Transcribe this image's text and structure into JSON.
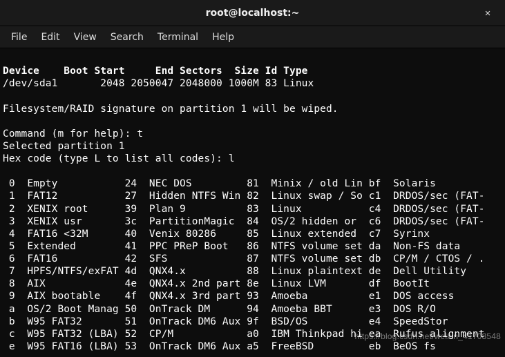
{
  "window": {
    "title": "root@localhost:~",
    "close_glyph": "×"
  },
  "menu": {
    "file": "File",
    "edit": "Edit",
    "view": "View",
    "search": "Search",
    "terminal": "Terminal",
    "help": "Help"
  },
  "header": {
    "cols": "Device    Boot Start     End Sectors  Size Id Type",
    "row1": "/dev/sda1       2048 2050047 2048000 1000M 83 Linux"
  },
  "msg": {
    "wipe": "Filesystem/RAID signature on partition 1 will be wiped.",
    "cmd_prompt": "Command (m for help): t",
    "selected": "Selected partition 1",
    "hex_prompt": "Hex code (type L to list all codes): l"
  },
  "codes": {
    "r00": " 0  Empty           24  NEC DOS         81  Minix / old Lin bf  Solaris",
    "r01": " 1  FAT12           27  Hidden NTFS Win 82  Linux swap / So c1  DRDOS/sec (FAT-",
    "r02": " 2  XENIX root      39  Plan 9          83  Linux           c4  DRDOS/sec (FAT-",
    "r03": " 3  XENIX usr       3c  PartitionMagic  84  OS/2 hidden or  c6  DRDOS/sec (FAT-",
    "r04": " 4  FAT16 <32M      40  Venix 80286     85  Linux extended  c7  Syrinx",
    "r05": " 5  Extended        41  PPC PReP Boot   86  NTFS volume set da  Non-FS data",
    "r06": " 6  FAT16           42  SFS             87  NTFS volume set db  CP/M / CTOS / .",
    "r07": " 7  HPFS/NTFS/exFAT 4d  QNX4.x          88  Linux plaintext de  Dell Utility",
    "r08": " 8  AIX             4e  QNX4.x 2nd part 8e  Linux LVM       df  BootIt",
    "r09": " 9  AIX bootable    4f  QNX4.x 3rd part 93  Amoeba          e1  DOS access",
    "r0a": " a  OS/2 Boot Manag 50  OnTrack DM      94  Amoeba BBT      e3  DOS R/O",
    "r0b": " b  W95 FAT32       51  OnTrack DM6 Aux 9f  BSD/OS          e4  SpeedStor",
    "r0c": " c  W95 FAT32 (LBA) 52  CP/M            a0  IBM Thinkpad hi ea  Rufus alignment",
    "r0e": " e  W95 FAT16 (LBA) 53  OnTrack DM6 Aux a5  FreeBSD         eb  BeOS fs"
  },
  "watermark": "https://blog.csdn.net/weixin_41708548"
}
